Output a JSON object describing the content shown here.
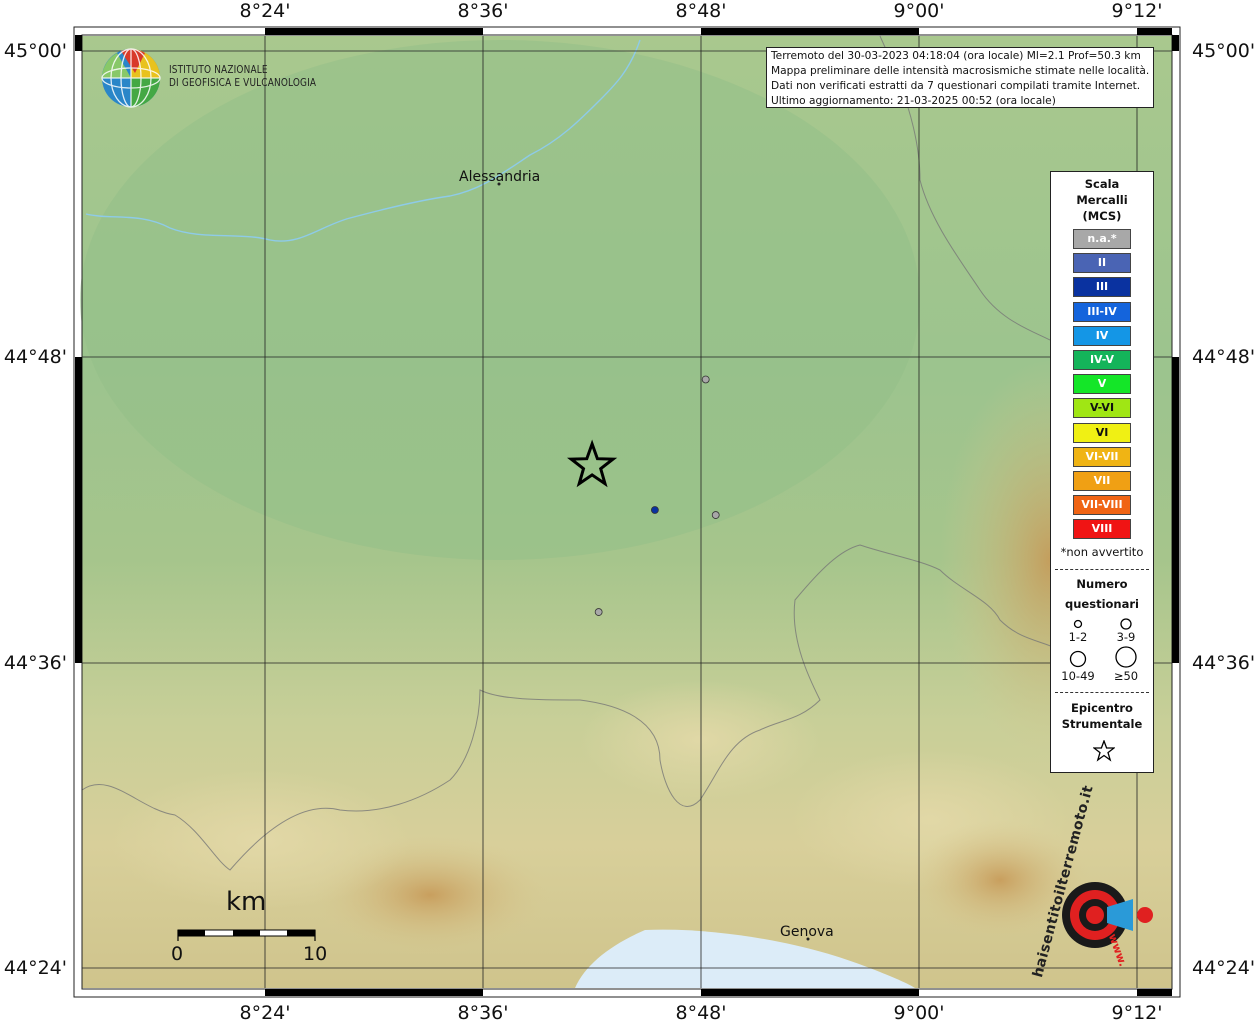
{
  "axes": {
    "lon_labels": [
      "8°24'",
      "8°36'",
      "8°48'",
      "9°00'",
      "9°12'"
    ],
    "lat_labels": [
      "45°00'",
      "44°48'",
      "44°36'",
      "44°24'"
    ]
  },
  "logo": {
    "line1": "ISTITUTO NAZIONALE",
    "line2": "DI GEOFISICA E VULCANOLOGIA"
  },
  "info_box": {
    "line1": "Terremoto del 30-03-2023 04:18:04 (ora locale) Ml=2.1 Prof=50.3 km",
    "line2": "Mappa preliminare delle intensità macrosismiche stimate nelle località.",
    "line3": "Dati non verificati estratti da 7 questionari compilati tramite Internet.",
    "line4": "Ultimo aggiornamento: 21-03-2025 00:52 (ora locale)"
  },
  "places": {
    "alessandria": "Alessandria",
    "genova": "Genova"
  },
  "legend": {
    "title1": "Scala",
    "title2": "Mercalli",
    "title3": "(MCS)",
    "scale": [
      {
        "label": "n.a.*",
        "color": "#a8a8a8"
      },
      {
        "label": "II",
        "color": "#4a64b4"
      },
      {
        "label": "III",
        "color": "#0a32a0"
      },
      {
        "label": "III-IV",
        "color": "#1464dc"
      },
      {
        "label": "IV",
        "color": "#1496e6"
      },
      {
        "label": "IV-V",
        "color": "#14b45a"
      },
      {
        "label": "V",
        "color": "#14e628"
      },
      {
        "label": "V-VI",
        "color": "#a0e614"
      },
      {
        "label": "VI",
        "color": "#f0f014"
      },
      {
        "label": "VI-VII",
        "color": "#f0b414"
      },
      {
        "label": "VII",
        "color": "#f0a014"
      },
      {
        "label": "VII-VIII",
        "color": "#f06414"
      },
      {
        "label": "VIII",
        "color": "#f01414"
      }
    ],
    "footnote": "*non avvertito",
    "count_title1": "Numero",
    "count_title2": "questionari",
    "count_labels": [
      "1-2",
      "3-9",
      "10-49",
      "≥50"
    ],
    "epi_title1": "Epicentro",
    "epi_title2": "Strumentale"
  },
  "scalebar": {
    "unit": "km",
    "start": "0",
    "end": "10"
  },
  "points": [
    {
      "lon": 8.8043,
      "lat": 44.7853,
      "color": "#a8a8a8",
      "r": 3.5
    },
    {
      "lon": 8.7577,
      "lat": 44.7,
      "color": "#0a32a0",
      "r": 3.5
    },
    {
      "lon": 8.8135,
      "lat": 44.6967,
      "color": "#a8a8a8",
      "r": 3.5
    },
    {
      "lon": 8.7061,
      "lat": 44.6333,
      "color": "#a8a8a8",
      "r": 3.5
    }
  ],
  "epicenter": {
    "lon": 8.7001,
    "lat": 44.7288
  },
  "watermark": {
    "text": "haisentitoilterremoto.it",
    "url_text": "www."
  }
}
